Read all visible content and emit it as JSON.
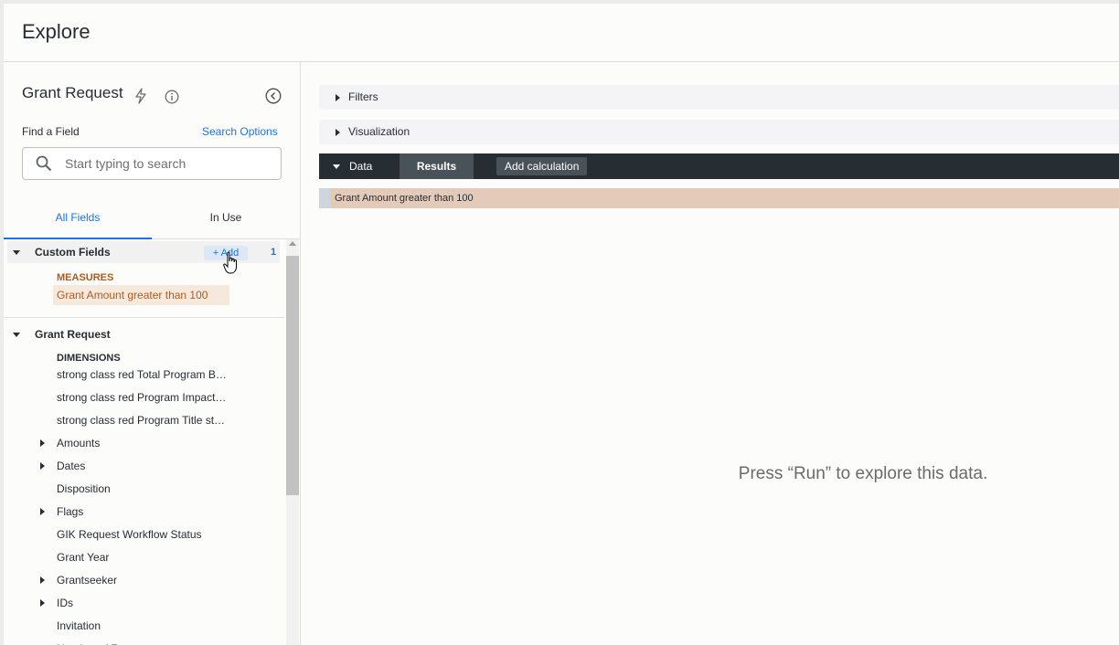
{
  "header": {
    "title": "Explore"
  },
  "sidebar": {
    "title": "Grant Request",
    "find_label": "Find a Field",
    "search_options": "Search Options",
    "search_placeholder": "Start typing to search",
    "tabs": {
      "all": "All Fields",
      "in_use": "In Use"
    },
    "custom_fields": {
      "label": "Custom Fields",
      "add_label": "+ Add",
      "count": "1",
      "measures_label": "MEASURES",
      "measure_item": "Grant Amount greater than 100"
    },
    "grant_request": {
      "label": "Grant Request",
      "dimensions_label": "DIMENSIONS",
      "items": [
        {
          "label": "strong class red Total Program B…",
          "expandable": false
        },
        {
          "label": "strong class red Program Impact…",
          "expandable": false
        },
        {
          "label": "strong class red Program Title st…",
          "expandable": false
        },
        {
          "label": "Amounts",
          "expandable": true
        },
        {
          "label": "Dates",
          "expandable": true
        },
        {
          "label": "Disposition",
          "expandable": false
        },
        {
          "label": "Flags",
          "expandable": true
        },
        {
          "label": "GIK Request Workflow Status",
          "expandable": false
        },
        {
          "label": "Grant Year",
          "expandable": false
        },
        {
          "label": "Grantseeker",
          "expandable": true
        },
        {
          "label": "IDs",
          "expandable": true
        },
        {
          "label": "Invitation",
          "expandable": false
        },
        {
          "label": "Number of Requests",
          "expandable": false
        }
      ]
    }
  },
  "main": {
    "filters_label": "Filters",
    "visualization_label": "Visualization",
    "data_label": "Data",
    "results_label": "Results",
    "add_calculation_label": "Add calculation",
    "column_name": "Grant Amount greater than 100",
    "empty_message": "Press “Run” to explore this data."
  },
  "colors": {
    "accent": "#1a73e8",
    "measure": "#b05b1e",
    "data_bar": "#262d33"
  }
}
